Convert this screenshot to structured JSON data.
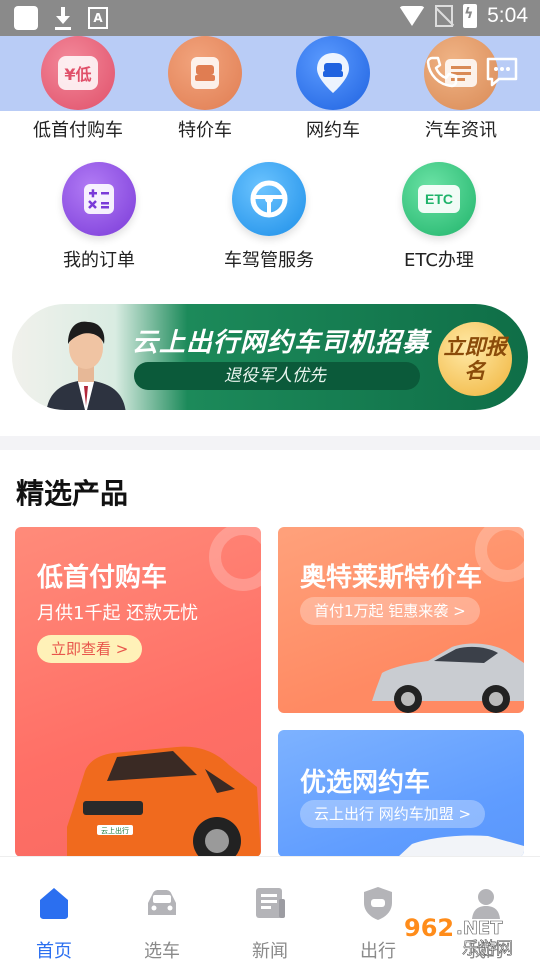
{
  "status_bar": {
    "time": "5:04",
    "a_badge": "A"
  },
  "top_row": [
    {
      "label": "低首付购车",
      "icon": "low-downpayment-icon",
      "icon_text": "¥低",
      "color": "#e8637c"
    },
    {
      "label": "特价车",
      "icon": "special-car-icon",
      "color": "#e6895f"
    },
    {
      "label": "网约车",
      "icon": "ride-hailing-icon",
      "color": "#2f7af0"
    },
    {
      "label": "汽车资讯",
      "icon": "car-news-icon",
      "color": "#e49a5e"
    }
  ],
  "second_row": [
    {
      "label": "我的订单",
      "icon": "my-orders-icon",
      "color": "#8b49e3"
    },
    {
      "label": "车驾管服务",
      "icon": "vehicle-service-icon",
      "color": "#2aa0ee"
    },
    {
      "label": "ETC办理",
      "icon": "etc-icon",
      "icon_text": "ETC",
      "color": "#2ec57a"
    }
  ],
  "banner": {
    "title": "云上出行网约车司机招募",
    "subtitle": "退役军人优先",
    "button": "立即报名"
  },
  "section": {
    "title": "精选产品"
  },
  "products": [
    {
      "title": "低首付购车",
      "subtitle": "月供1千起 还款无忧",
      "button": "立即查看 >",
      "plate": "云上出行"
    },
    {
      "title": "奥特莱斯特价车",
      "button": "首付1万起 钜惠来袭 >"
    },
    {
      "title": "优选网约车",
      "button": "云上出行 网约车加盟 >"
    }
  ],
  "bottom_nav": [
    {
      "label": "首页",
      "icon": "home-icon",
      "active": true
    },
    {
      "label": "选车",
      "icon": "car-select-icon",
      "active": false
    },
    {
      "label": "新闻",
      "icon": "news-icon",
      "active": false
    },
    {
      "label": "出行",
      "icon": "travel-icon",
      "active": false
    },
    {
      "label": "我的",
      "icon": "profile-icon",
      "active": false
    }
  ],
  "watermark": {
    "number": "962",
    "suffix": ".NET",
    "text": "乐游网"
  },
  "colors": {
    "primary": "#2b6ff0",
    "header_bg": "#b9ccf6"
  }
}
